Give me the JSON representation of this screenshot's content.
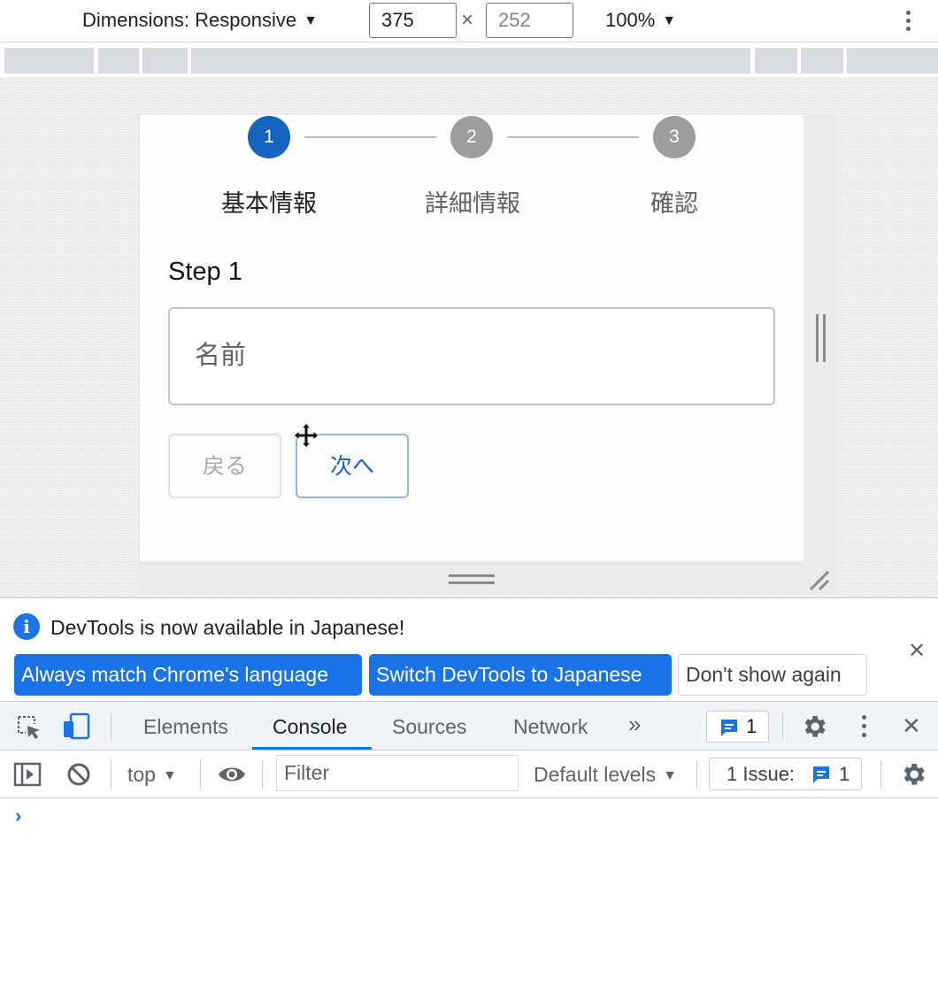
{
  "device_toolbar": {
    "dimensions_label": "Dimensions: Responsive",
    "width_value": "375",
    "height_value": "252",
    "times_symbol": "×",
    "zoom_label": "100%",
    "caret": "▼"
  },
  "page": {
    "steps": [
      {
        "number": "1",
        "label": "基本情報",
        "state": "active",
        "color": "#1565c0"
      },
      {
        "number": "2",
        "label": "詳細情報",
        "state": "inactive",
        "color": "#9e9e9e"
      },
      {
        "number": "3",
        "label": "確認",
        "state": "inactive",
        "color": "#9e9e9e"
      }
    ],
    "step_title": "Step 1",
    "name_field_placeholder": "名前",
    "back_label": "戻る",
    "next_label": "次へ"
  },
  "infobar": {
    "message": "DevTools is now available in Japanese!",
    "info_icon": "i",
    "close_icon": "✕",
    "match_label": "Always match Chrome's language",
    "switch_label": "Switch DevTools to Japanese",
    "dont_show_label": "Don't show again",
    "accent_color": "#1a73e8"
  },
  "devtools": {
    "tabs": [
      {
        "label": "Elements"
      },
      {
        "label": "Console",
        "active": true
      },
      {
        "label": "Sources"
      },
      {
        "label": "Network"
      }
    ],
    "more_tabs_icon": "»",
    "issues_chip_count": "1",
    "close_icon": "✕",
    "console": {
      "context": "top",
      "caret": "▼",
      "filter_placeholder": "Filter",
      "levels": "Default levels",
      "issue_label": "1 Issue:",
      "issue_count": "1",
      "prompt": "›"
    }
  }
}
